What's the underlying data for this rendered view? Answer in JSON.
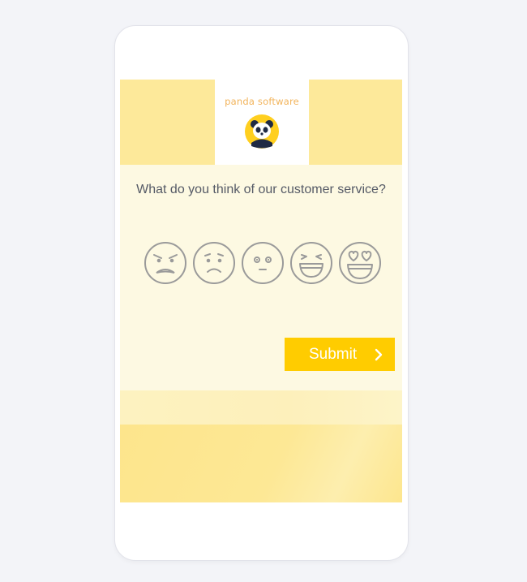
{
  "brand": {
    "name": "panda software",
    "logo_icon": "panda-icon",
    "accent": "#f2b45c"
  },
  "survey": {
    "question": "What do you think of our customer service?",
    "ratings": [
      {
        "name": "very-dissatisfied-face-icon",
        "icon": "angry-face"
      },
      {
        "name": "dissatisfied-face-icon",
        "icon": "sad-face"
      },
      {
        "name": "neutral-face-icon",
        "icon": "neutral-face"
      },
      {
        "name": "satisfied-face-icon",
        "icon": "grinning-face"
      },
      {
        "name": "very-satisfied-face-icon",
        "icon": "heart-eyes-face"
      }
    ]
  },
  "submit": {
    "label": "Submit",
    "icon": "chevron-right-icon",
    "color": "#ffcc00"
  },
  "colors": {
    "background": "#f3f4f8",
    "header_band": "#fde99a",
    "content_bg": "#fdf9e2",
    "face_stroke": "#9a9a9a",
    "question_text": "#555a66"
  }
}
